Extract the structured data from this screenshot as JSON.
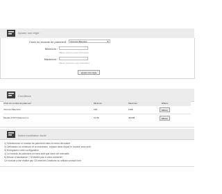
{
  "add_section": {
    "title": "Ajouter une règle",
    "module_label": "Choix du module de paiement",
    "module_selected": "Virement Bancaire",
    "min_label": "Minimum",
    "min_value": "",
    "min_hint": "Valeur minimum pour l'activation",
    "max_label": "Maximum",
    "max_value": "",
    "max_hint": "Valeur maximum pour l'activation",
    "submit_label": "ajouter une règle"
  },
  "conditions_section": {
    "title": "Conditions",
    "columns": [
      "Choix du module de paiement",
      "Minimum",
      "Maximum",
      "Effacer"
    ],
    "rows": [
      {
        "module": "Virement Bancaire",
        "min": "10€",
        "max": "100€",
        "action": "Effacer"
      },
      {
        "module": "Module 4TOO Paiement 1x",
        "min": "10,2€",
        "max": "48,83€",
        "action": "Effacer"
      }
    ]
  },
  "notes_section": {
    "title": "Notes installation facile",
    "lines": [
      "1) Sélectionnez le module de paiement dans le menu déroulant",
      "2) Définissez un minimum et un maximum, espace dans lequel le module sera actif",
      "3) Enregistrez votre configuration",
      "4) Le module de paiement ne sera actif que dans cet intervalle",
      "5) Besoin d'assistance ? N'hésitez pas à nous contacter",
      "Ce module a été réalisé par CS-Internet-Créations ou utilisez contact form"
    ]
  },
  "colors": {
    "header_bg": "#ececec",
    "border": "#d6d6d6"
  }
}
